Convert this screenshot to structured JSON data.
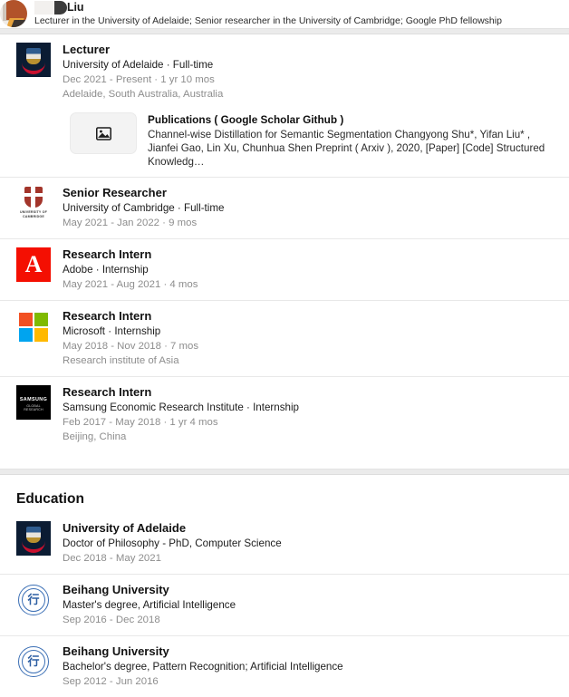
{
  "header": {
    "name_suffix": "Liu",
    "headline": "Lecturer in the University of Adelaide; Senior researcher in the University of Cambridge; Google PhD fellowship",
    "avatar_icon": "profile-avatar-books"
  },
  "experience": {
    "entries": [
      {
        "role": "Lecturer",
        "org": "University of Adelaide · Full-time",
        "dates": "Dec 2021 - Present · 1 yr 10 mos",
        "location": "Adelaide, South Australia, Australia",
        "logo_icon": "university-of-adelaide-logo",
        "media": {
          "thumb_icon": "image-placeholder-icon",
          "title": "Publications ( Google Scholar Github )",
          "description": "Channel-wise Distillation for Semantic Segmentation Changyong Shu*, Yifan Liu* , Jianfei Gao, Lin Xu, Chunhua Shen Preprint ( Arxiv ), 2020, [Paper] [Code] Structured Knowledg…"
        }
      },
      {
        "role": "Senior Researcher",
        "org": "University of Cambridge · Full-time",
        "dates": "May 2021 - Jan 2022 · 9 mos",
        "location": "",
        "logo_icon": "university-of-cambridge-logo",
        "logo_caption_line1": "UNIVERSITY OF",
        "logo_caption_line2": "CAMBRIDGE"
      },
      {
        "role": "Research Intern",
        "org": "Adobe · Internship",
        "dates": "May 2021 - Aug 2021 · 4 mos",
        "location": "",
        "logo_icon": "adobe-logo",
        "logo_glyph": "A"
      },
      {
        "role": "Research Intern",
        "org": "Microsoft · Internship",
        "dates": "May 2018 - Nov 2018 · 7 mos",
        "location": "Research institute of Asia",
        "logo_icon": "microsoft-logo"
      },
      {
        "role": "Research Intern",
        "org": "Samsung Economic Research Institute · Internship",
        "dates": "Feb 2017 - May 2018 · 1 yr 4 mos",
        "location": "Beijing, China",
        "logo_icon": "samsung-logo",
        "logo_caption_line1": "SAMSUNG",
        "logo_caption_line2": "GLOBAL RESEARCH"
      }
    ]
  },
  "education": {
    "title": "Education",
    "entries": [
      {
        "school": "University of Adelaide",
        "degree": "Doctor of Philosophy - PhD, Computer Science",
        "dates": "Dec 2018 - May 2021",
        "logo_icon": "university-of-adelaide-logo"
      },
      {
        "school": "Beihang University",
        "degree": "Master's degree, Artificial Intelligence",
        "dates": "Sep 2016 - Dec 2018",
        "logo_icon": "beihang-university-logo",
        "logo_glyph": "行"
      },
      {
        "school": "Beihang University",
        "degree": "Bachelor's degree, Pattern Recognition; Artificial Intelligence",
        "dates": "Sep 2012 - Jun 2016",
        "logo_icon": "beihang-university-logo",
        "logo_glyph": "行"
      }
    ]
  },
  "colors": {
    "adobe_red": "#f40f02",
    "adelaide_navy": "#0b1c33",
    "cambridge_red": "#a3352b",
    "beihang_blue": "#2e5fa3",
    "muted_text": "#8d8d8d",
    "divider": "#e8e8e8",
    "band": "#ebebeb"
  }
}
